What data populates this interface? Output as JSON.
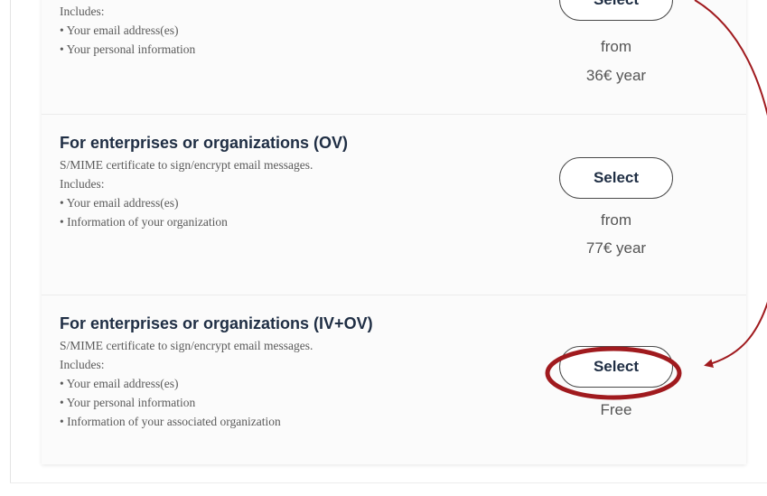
{
  "plans": [
    {
      "lines": [
        "Includes:",
        "• Your email address(es)",
        "• Your personal information"
      ],
      "button_label": "Select",
      "price_line1": "from",
      "price_line2": "36€ year"
    },
    {
      "title": "For enterprises or organizations (OV)",
      "lines": [
        "S/MIME certificate to sign/encrypt email messages.",
        "Includes:",
        "• Your email address(es)",
        "• Information of your organization"
      ],
      "button_label": "Select",
      "price_line1": "from",
      "price_line2": "77€ year"
    },
    {
      "title": "For enterprises or organizations (IV+OV)",
      "lines": [
        "S/MIME certificate to sign/encrypt email messages.",
        "Includes:",
        "• Your email address(es)",
        "• Your personal information",
        "• Information of your associated organization"
      ],
      "button_label": "Select",
      "price_line1": "Free"
    }
  ],
  "annotation": {
    "highlight_color": "#a01a1e",
    "arrow_color": "#a01a1e"
  }
}
